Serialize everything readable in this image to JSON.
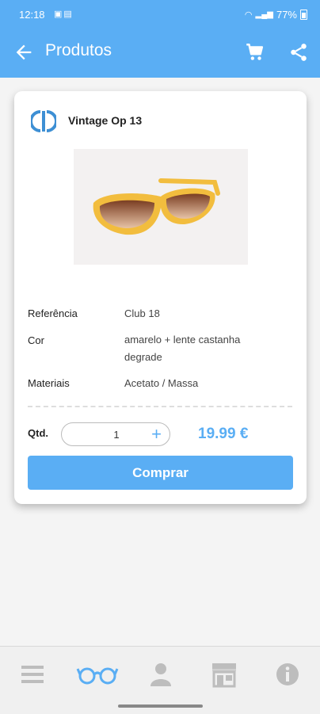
{
  "status_bar": {
    "time": "12:18",
    "battery": "77%"
  },
  "header": {
    "title": "Produtos"
  },
  "product": {
    "name": "Vintage Op 13",
    "specs": [
      {
        "label": "Referência",
        "value": "Club 18"
      },
      {
        "label": "Cor",
        "value": "amarelo + lente castanha degrade"
      },
      {
        "label": "Materiais",
        "value": "Acetato / Massa"
      }
    ],
    "quantity_label": "Qtd.",
    "quantity": "1",
    "price": "19.99 €",
    "buy_label": "Comprar"
  },
  "colors": {
    "primary": "#5aaef4",
    "nav_inactive": "#bdbdbd"
  },
  "bottom_nav": [
    {
      "icon": "menu-icon",
      "active": false
    },
    {
      "icon": "glasses-icon",
      "active": true
    },
    {
      "icon": "user-icon",
      "active": false
    },
    {
      "icon": "store-icon",
      "active": false
    },
    {
      "icon": "info-icon",
      "active": false
    }
  ]
}
